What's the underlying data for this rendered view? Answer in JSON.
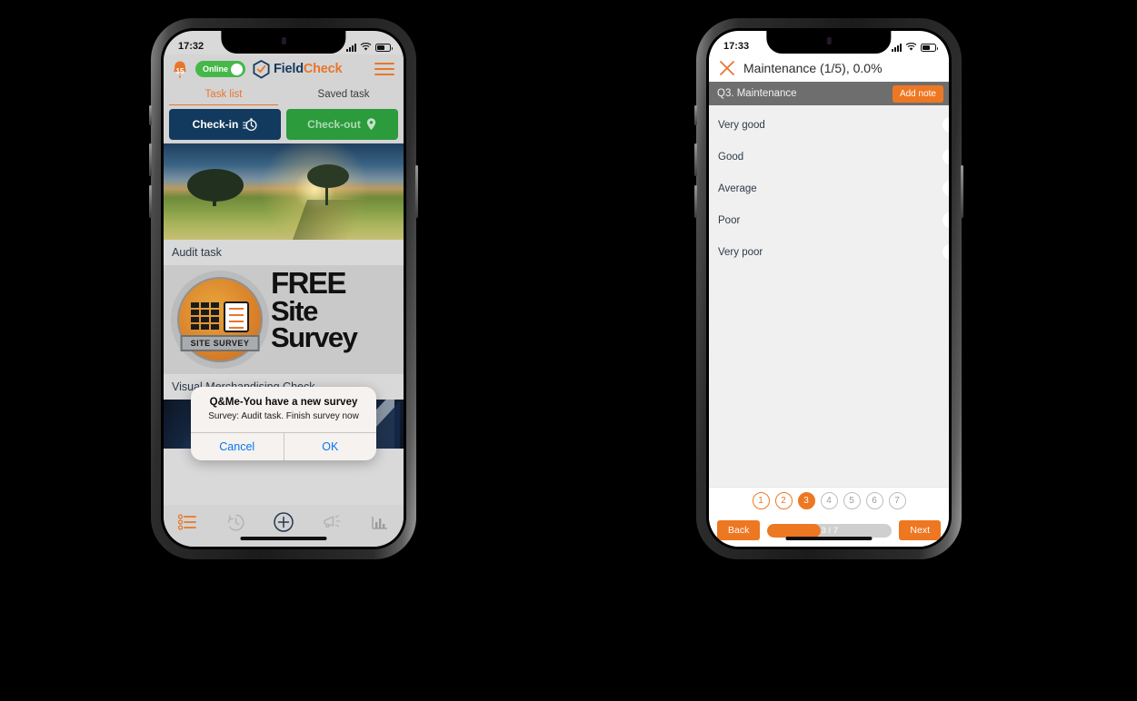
{
  "background_color": "#000000",
  "accent_orange": "#ee7722",
  "phone1": {
    "status_bar": {
      "time": "17:32"
    },
    "app_bar": {
      "notification_count": "15",
      "online_label": "Online",
      "brand_first": "Field",
      "brand_second": "Check"
    },
    "tabs": [
      {
        "label": "Task list",
        "active": true
      },
      {
        "label": "Saved task",
        "active": false
      }
    ],
    "actions": [
      {
        "label": "Check-in",
        "color": "#123a5e"
      },
      {
        "label": "Check-out",
        "color": "#2b9b3c"
      }
    ],
    "cards": [
      {
        "title": "Audit task"
      },
      {
        "title": "Visual Merchandising Check"
      }
    ],
    "banner": {
      "line1": "FREE",
      "line2": "Site",
      "line3": "Survey",
      "badge": "SITE SURVEY"
    },
    "nav_items": [
      {
        "icon": "task-list-icon",
        "active": true
      },
      {
        "icon": "history-clock-icon",
        "active": false
      },
      {
        "icon": "add-plus-icon",
        "active": false
      },
      {
        "icon": "megaphone-icon",
        "active": false
      },
      {
        "icon": "chart-bar-icon",
        "active": false
      }
    ],
    "dialog": {
      "title": "Q&Me-You have a new survey",
      "message": "Survey: Audit task. Finish survey now",
      "cancel_label": "Cancel",
      "ok_label": "OK"
    }
  },
  "phone2": {
    "status_bar": {
      "time": "17:33"
    },
    "header": {
      "title": "Maintenance (1/5), 0.0%",
      "close_icon": "close-x-icon"
    },
    "question_bar": {
      "label": "Q3. Maintenance",
      "add_note_label": "Add note"
    },
    "options": [
      {
        "label": "Very good",
        "selected": false
      },
      {
        "label": "Good",
        "selected": false
      },
      {
        "label": "Average",
        "selected": false
      },
      {
        "label": "Poor",
        "selected": false
      },
      {
        "label": "Very poor",
        "selected": false
      }
    ],
    "pager": [
      {
        "number": "1",
        "state": "done"
      },
      {
        "number": "2",
        "state": "done"
      },
      {
        "number": "3",
        "state": "active"
      },
      {
        "number": "4",
        "state": "pending"
      },
      {
        "number": "5",
        "state": "pending"
      },
      {
        "number": "6",
        "state": "pending"
      },
      {
        "number": "7",
        "state": "pending"
      }
    ],
    "footer": {
      "back_label": "Back",
      "next_label": "Next",
      "progress_text": "3 / 7",
      "progress_percent": 43
    }
  }
}
